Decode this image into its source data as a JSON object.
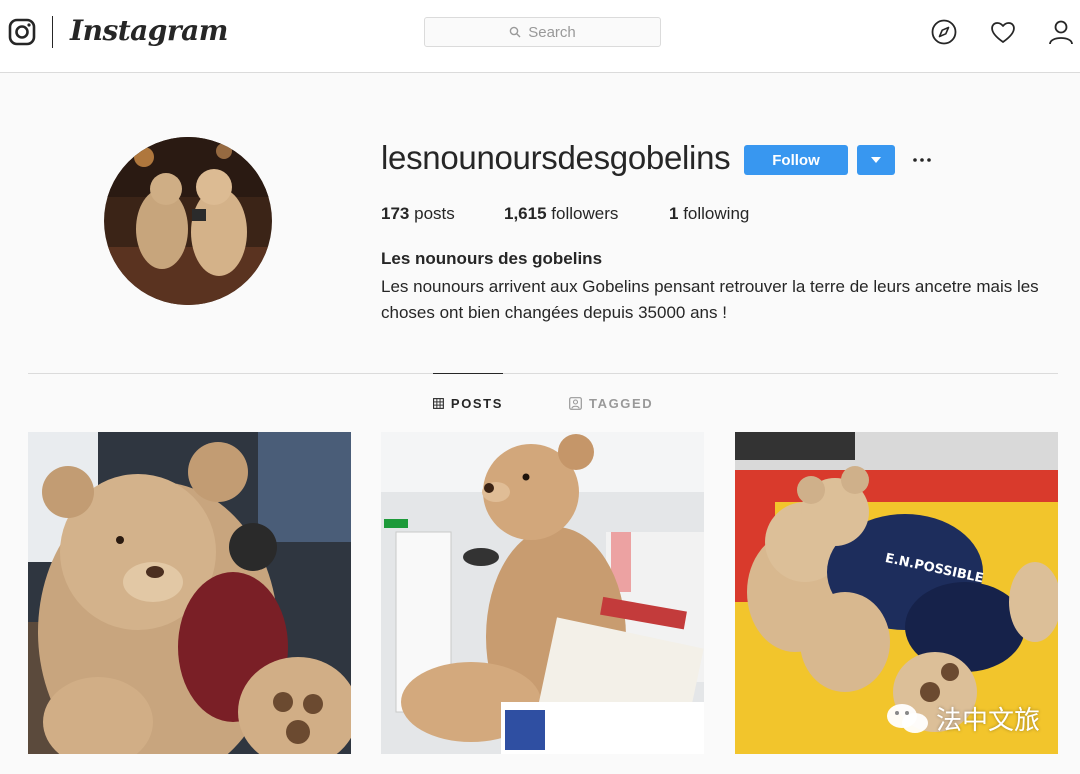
{
  "nav": {
    "brand": "Instagram",
    "search_placeholder": "Search",
    "icons": [
      "explore-compass-icon",
      "activity-heart-icon",
      "profile-person-icon"
    ]
  },
  "profile": {
    "username": "lesnounoursdesgobelins",
    "follow_label": "Follow",
    "stats": {
      "posts_count": "173",
      "posts_label": "posts",
      "followers_count": "1,615",
      "followers_label": "followers",
      "following_count": "1",
      "following_label": "following"
    },
    "full_name": "Les nounours des gobelins",
    "bio": "Les nounours arrivent aux Gobelins pensant retrouver la terre de leurs ancetre mais les choses ont bien changées depuis 35000 ans !"
  },
  "tabs": [
    {
      "label": "POSTS",
      "active": true
    },
    {
      "label": "TAGGED",
      "active": false
    }
  ],
  "posts": [
    {
      "subject": "teddy bear hugging a person"
    },
    {
      "subject": "teddy bear reading Les Echos newspaper"
    },
    {
      "subject": "teddy bears on a judo mat",
      "jersey_text": "E.N.POSSIBLE"
    }
  ],
  "watermark": "法中文旅",
  "colors": {
    "accent": "#3897f0",
    "text": "#262626",
    "muted": "#999999",
    "border": "#dbdbdb",
    "background": "#fafafa"
  }
}
